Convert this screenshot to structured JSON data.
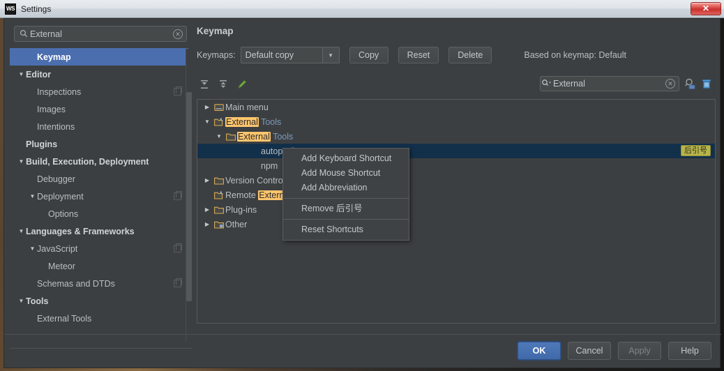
{
  "window": {
    "title": "Settings",
    "logo_text": "WS",
    "close_label": "✕"
  },
  "sidebar": {
    "search": {
      "value": "External",
      "placeholder": "",
      "icon": "search-icon",
      "clear_icon": "clear-icon"
    },
    "items": [
      {
        "label": "Keymap",
        "indent": 1,
        "arrow": "",
        "bold": true,
        "selected": true,
        "badge": false
      },
      {
        "label": "Editor",
        "indent": 0,
        "arrow": "▼",
        "bold": true,
        "selected": false,
        "badge": false
      },
      {
        "label": "Inspections",
        "indent": 1,
        "arrow": "",
        "bold": false,
        "selected": false,
        "badge": true
      },
      {
        "label": "Images",
        "indent": 1,
        "arrow": "",
        "bold": false,
        "selected": false,
        "badge": false
      },
      {
        "label": "Intentions",
        "indent": 1,
        "arrow": "",
        "bold": false,
        "selected": false,
        "badge": false
      },
      {
        "label": "Plugins",
        "indent": 0,
        "arrow": "",
        "bold": true,
        "selected": false,
        "badge": false
      },
      {
        "label": "Build, Execution, Deployment",
        "indent": 0,
        "arrow": "▼",
        "bold": true,
        "selected": false,
        "badge": false
      },
      {
        "label": "Debugger",
        "indent": 1,
        "arrow": "",
        "bold": false,
        "selected": false,
        "badge": false
      },
      {
        "label": "Deployment",
        "indent": 1,
        "arrow": "▼",
        "bold": false,
        "selected": false,
        "badge": true
      },
      {
        "label": "Options",
        "indent": 2,
        "arrow": "",
        "bold": false,
        "selected": false,
        "badge": false
      },
      {
        "label": "Languages & Frameworks",
        "indent": 0,
        "arrow": "▼",
        "bold": true,
        "selected": false,
        "badge": false
      },
      {
        "label": "JavaScript",
        "indent": 1,
        "arrow": "▼",
        "bold": false,
        "selected": false,
        "badge": true
      },
      {
        "label": "Meteor",
        "indent": 2,
        "arrow": "",
        "bold": false,
        "selected": false,
        "badge": false
      },
      {
        "label": "Schemas and DTDs",
        "indent": 1,
        "arrow": "",
        "bold": false,
        "selected": false,
        "badge": true
      },
      {
        "label": "Tools",
        "indent": 0,
        "arrow": "▼",
        "bold": true,
        "selected": false,
        "badge": false
      },
      {
        "label": "External Tools",
        "indent": 1,
        "arrow": "",
        "bold": false,
        "selected": false,
        "badge": false
      }
    ]
  },
  "main": {
    "title": "Keymap",
    "keymaps_label": "Keymaps:",
    "keymap_selected": "Default copy",
    "buttons": {
      "copy": "Copy",
      "reset": "Reset",
      "delete": "Delete"
    },
    "based_on": "Based on keymap: Default",
    "toolbar": {
      "expand_all": "expand-all-icon",
      "collapse_all": "collapse-all-icon",
      "edit": "edit-pencil-icon"
    },
    "filter": {
      "value": "External",
      "icon": "search-dropdown-icon",
      "clear_icon": "clear-icon"
    },
    "find_icon": "find-shortcut-icon",
    "trash_icon": "trash-icon",
    "tree": [
      {
        "arrow": "▶",
        "indent": 0,
        "icon": "main-menu-icon",
        "pre": "Main menu",
        "hl": "",
        "post": "",
        "selected": false,
        "badge": ""
      },
      {
        "arrow": "▼",
        "indent": 0,
        "icon": "ext-tools-icon",
        "pre": "",
        "hl": "External",
        "post": " Tools",
        "selected": false,
        "badge": ""
      },
      {
        "arrow": "▼",
        "indent": 1,
        "icon": "folder-icon",
        "pre": "",
        "hl": "External",
        "post": " Tools",
        "selected": false,
        "badge": ""
      },
      {
        "arrow": "",
        "indent": 3,
        "icon": "",
        "pre": "autoprefixer",
        "hl": "",
        "post": "",
        "selected": true,
        "badge": "后引号"
      },
      {
        "arrow": "",
        "indent": 3,
        "icon": "",
        "pre": "npm",
        "hl": "",
        "post": "",
        "selected": false,
        "badge": ""
      },
      {
        "arrow": "▶",
        "indent": 0,
        "icon": "folder-icon",
        "pre": "Version Control",
        "hl": "",
        "post": "",
        "selected": false,
        "badge": ""
      },
      {
        "arrow": "",
        "indent": 0,
        "icon": "ext-tools-icon",
        "pre": "Remote ",
        "hl": "External",
        "post": " Tools",
        "selected": false,
        "badge": ""
      },
      {
        "arrow": "▶",
        "indent": 0,
        "icon": "folder-icon",
        "pre": "Plug-ins",
        "hl": "",
        "post": "",
        "selected": false,
        "badge": ""
      },
      {
        "arrow": "▶",
        "indent": 0,
        "icon": "other-icon",
        "pre": "Other",
        "hl": "",
        "post": "",
        "selected": false,
        "badge": ""
      }
    ],
    "context_menu": [
      {
        "label": "Add Keyboard Shortcut",
        "sep_after": false
      },
      {
        "label": "Add Mouse Shortcut",
        "sep_after": false
      },
      {
        "label": "Add Abbreviation",
        "sep_after": true
      },
      {
        "label": "Remove 后引号",
        "sep_after": true
      },
      {
        "label": "Reset Shortcuts",
        "sep_after": false
      }
    ]
  },
  "footer": {
    "ok": "OK",
    "cancel": "Cancel",
    "apply": "Apply",
    "help": "Help"
  },
  "colors": {
    "selection_blue": "#4b6eaf",
    "tree_selection": "#13304b",
    "highlight_yellow": "#ffc66d",
    "badge_olive": "#b7b44a",
    "panel_bg": "#3c3f41"
  }
}
